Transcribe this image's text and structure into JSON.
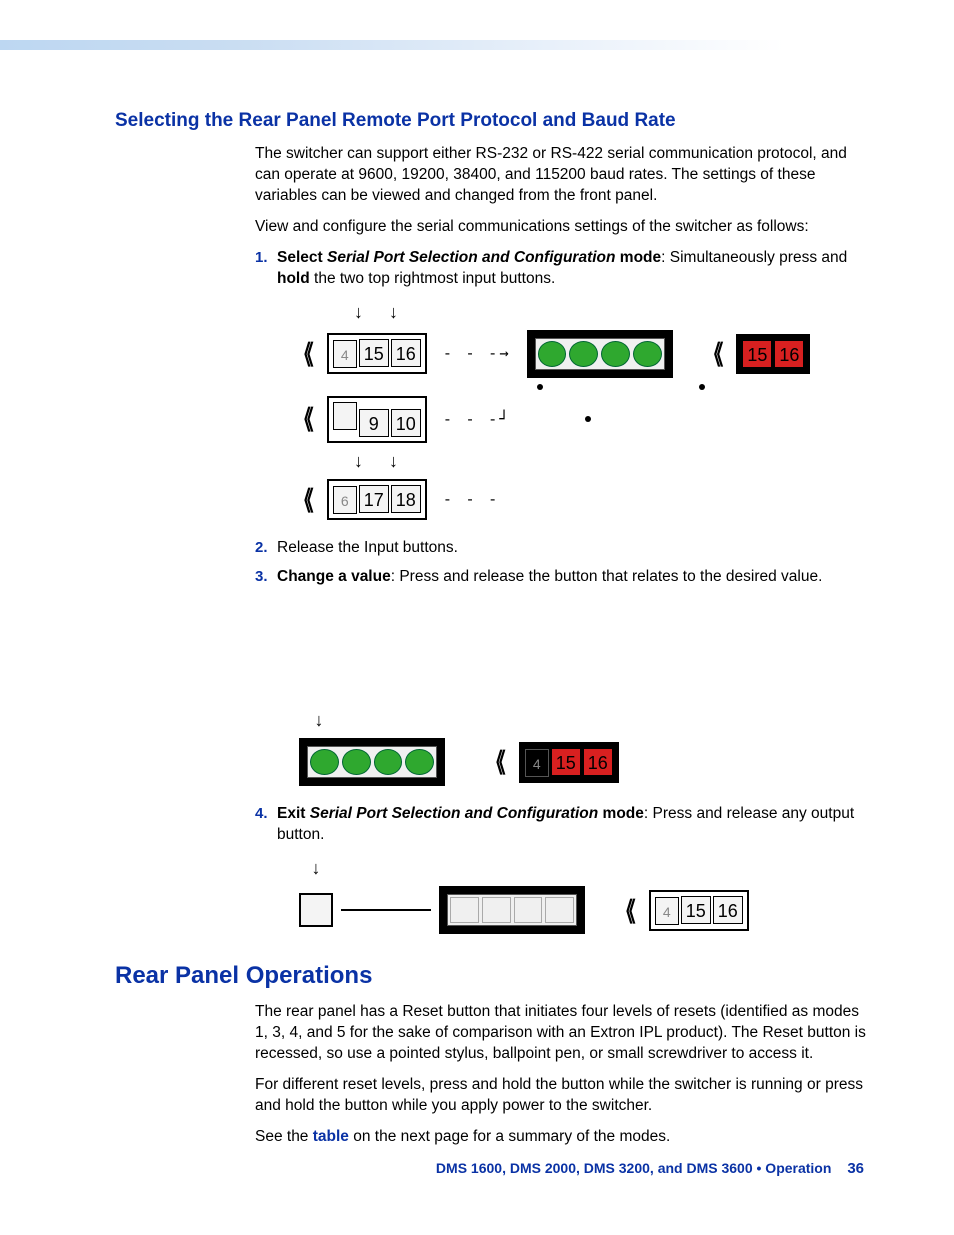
{
  "section1": {
    "title": "Selecting the Rear Panel Remote Port Protocol and Baud Rate",
    "para1": "The switcher can support either RS-232 or RS-422 serial communication protocol, and can operate at 9600, 19200, 38400, and 115200 baud rates. The settings of these variables can be viewed and changed from the front panel.",
    "para2": "View and configure the serial communications settings of the switcher as follows:",
    "step1a": "Select ",
    "step1b": "Serial Port Selection and Configuration",
    "step1c": " mode",
    "step1d": ": Simultaneously press and ",
    "step1e": "hold",
    "step1f": " the two top rightmost input buttons.",
    "step2": "Release the Input buttons.",
    "step3a": "Change a value",
    "step3b": ": Press and release the button that relates to the desired value.",
    "step4a": "Exit ",
    "step4b": "Serial Port Selection and Configuration",
    "step4c": " mode",
    "step4d": ": Press and release any output button."
  },
  "section2": {
    "title": "Rear Panel Operations",
    "para1": "The rear panel has a Reset button that initiates four levels of resets (identified as modes 1, 3, 4, and 5 for the sake of comparison with an Extron IPL product). The Reset button is recessed, so use a pointed stylus, ballpoint pen, or small screwdriver to access it.",
    "para2": "For different reset levels, press and hold the button while the switcher is running or press and hold the button while you apply power to the switcher.",
    "para3a": "See the ",
    "para3b": "table",
    "para3c": " on the next page for a summary of the modes."
  },
  "diagram": {
    "b15": "15",
    "b16": "16",
    "b9": "9",
    "b10": "10",
    "b17": "17",
    "b18": "18"
  },
  "footer": {
    "text": "DMS 1600, DMS 2000, DMS 3200, and DMS 3600 • Operation",
    "page": "36"
  }
}
